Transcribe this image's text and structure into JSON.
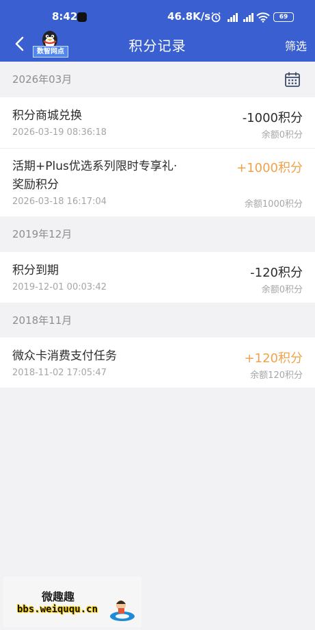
{
  "statusbar": {
    "time": "8:42",
    "speed": "46.8K/s",
    "signal1": "HD",
    "signal2": "HD",
    "battery": "69"
  },
  "nav": {
    "title": "积分记录",
    "filter_label": "筛选",
    "logo_text": "数智网点"
  },
  "colors": {
    "header": "#3a5fd0",
    "positive": "#f0a24a",
    "negative": "#2b2b2b"
  },
  "months": [
    {
      "label": "2026年03月",
      "records": [
        {
          "title": "积分商城兑换",
          "time": "2026-03-19 08:36:18",
          "amount": "-1000积分",
          "balance": "余额0积分"
        },
        {
          "title": "活期+Plus优选系列限时专享礼·",
          "title_line2": "奖励积分",
          "time": "2026-03-18 16:17:04",
          "amount": "+1000积分",
          "balance": "余额1000积分"
        }
      ]
    },
    {
      "label": "2019年12月",
      "records": [
        {
          "title": "积分到期",
          "time": "2019-12-01 00:03:42",
          "amount": "-120积分",
          "balance": "余额0积分"
        }
      ]
    },
    {
      "label": "2018年11月",
      "records": [
        {
          "title": "微众卡消费支付任务",
          "time": "2018-11-02 17:05:47",
          "amount": "+120积分",
          "balance": "余额120积分"
        }
      ]
    }
  ],
  "watermark": {
    "cn": "微趣趣",
    "url": "bbs.weiququ.cn"
  }
}
